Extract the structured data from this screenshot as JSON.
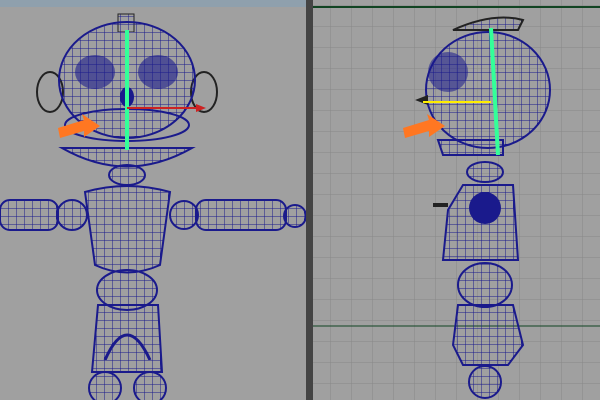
{
  "viewports": [
    {
      "name": "front",
      "grid": false,
      "background": "#a0a0a0"
    },
    {
      "name": "side",
      "grid": true,
      "background": "#a0a0a0"
    }
  ],
  "colors": {
    "wireframe": "#1a1a8c",
    "outline": "#222222",
    "y_axis": "#33ff99",
    "x_axis": "#cc2222",
    "z_axis": "#ffee00",
    "arrow": "#ff7722",
    "grid": "#888888",
    "grid_axis": "#114422",
    "divider": "#444444"
  }
}
